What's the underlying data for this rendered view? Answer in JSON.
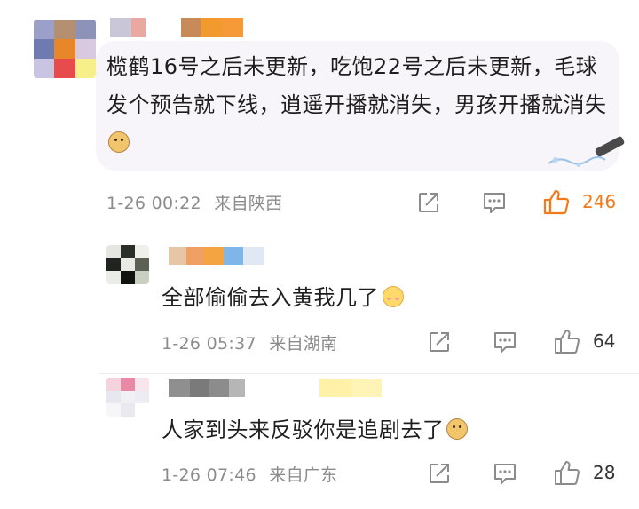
{
  "comments": [
    {
      "text": "榄鹤16号之后未更新，吃饱22号之后未更新，毛球发个预告就下线，逍遥开播就消失，男孩开播就消失",
      "emoji": "doge-emoji",
      "date": "1-26 00:22",
      "location": "来自陕西",
      "likes": "246",
      "liked": true
    },
    {
      "text": "全部偷偷去入黄我几了",
      "emoji": "blush-emoji",
      "date": "1-26 05:37",
      "location": "来自湖南",
      "likes": "64",
      "liked": false
    },
    {
      "text": "人家到头来反驳你是追剧去了",
      "emoji": "doge-emoji",
      "date": "1-26 07:46",
      "location": "来自广东",
      "likes": "28",
      "liked": false
    }
  ],
  "icons": {
    "share": "share-icon",
    "comment": "comment-icon",
    "like": "thumbs-up-icon"
  },
  "colors": {
    "accent_like": "#f27a1a",
    "meta_gray": "#8b8b8b",
    "bubble_bg": "#f7f5fa"
  }
}
